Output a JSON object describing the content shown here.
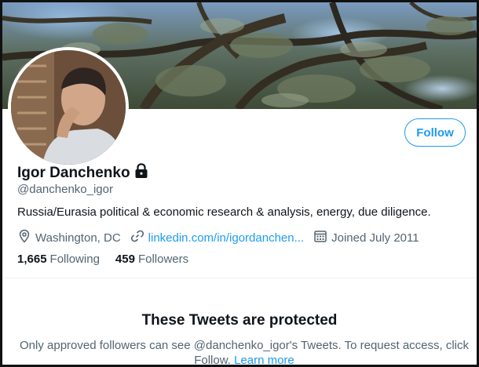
{
  "profile": {
    "display_name": "Igor Danchenko",
    "handle": "@danchenko_igor",
    "bio": "Russia/Eurasia political & economic research & analysis, energy, due diligence.",
    "location": "Washington, DC",
    "website": "linkedin.com/in/igordanchen...",
    "joined": "Joined July 2011",
    "following_count": "1,665",
    "following_label": "Following",
    "followers_count": "459",
    "followers_label": "Followers",
    "protected_icon": "lock-icon"
  },
  "actions": {
    "follow_label": "Follow"
  },
  "protected_notice": {
    "title": "These Tweets are protected",
    "body": "Only approved followers can see @danchenko_igor's Tweets. To request access, click Follow.",
    "learn_more": "Learn more"
  },
  "colors": {
    "accent": "#1d9bf0",
    "secondary_text": "#536471",
    "primary_text": "#0f1419"
  }
}
